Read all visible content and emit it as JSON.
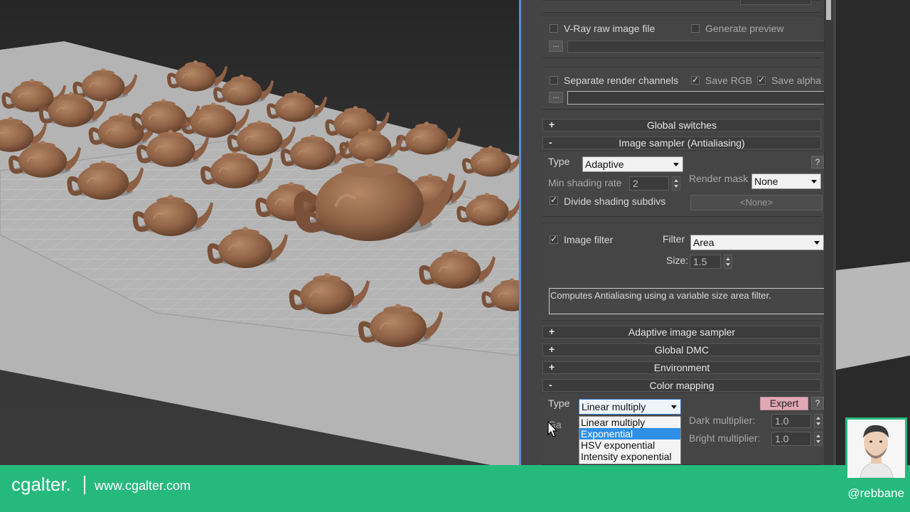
{
  "panel": {
    "vray_raw_label": "V-Ray raw image file",
    "generate_preview_label": "Generate preview",
    "browse_label": "...",
    "separate_channels_label": "Separate render channels",
    "save_rgb_label": "Save RGB",
    "save_alpha_label": "Save alpha",
    "rollouts": {
      "global_switches": {
        "sign": "+",
        "title": "Global switches"
      },
      "image_sampler": {
        "sign": "-",
        "title": "Image sampler (Antialiasing)"
      },
      "adaptive_sampler": {
        "sign": "+",
        "title": "Adaptive image sampler"
      },
      "global_dmc": {
        "sign": "+",
        "title": "Global DMC"
      },
      "environment": {
        "sign": "+",
        "title": "Environment"
      },
      "color_mapping": {
        "sign": "-",
        "title": "Color mapping"
      }
    },
    "image_sampler": {
      "type_label": "Type",
      "type_value": "Adaptive",
      "help_label": "?",
      "min_shading_label": "Min shading rate",
      "min_shading_value": "2",
      "render_mask_label": "Render mask",
      "render_mask_value": "None",
      "divide_subdivs_label": "Divide shading subdivs",
      "none_button": "<None>",
      "image_filter_label": "Image filter",
      "filter_label": "Filter",
      "filter_value": "Area",
      "size_label": "Size:",
      "size_value": "1.5",
      "description": "Computes Antialiasing using a variable size area filter."
    },
    "color_mapping": {
      "type_label": "Type",
      "type_value": "Linear multiply",
      "expert_label": "Expert",
      "help_label": "?",
      "gamma_label": "Ga",
      "dark_label": "Dark multiplier:",
      "dark_value": "1.0",
      "bright_label": "Bright multiplier:",
      "bright_value": "1.0",
      "options": [
        "Linear multiply",
        "Exponential",
        "HSV exponential",
        "Intensity exponential"
      ],
      "highlighted": "Exponential"
    }
  },
  "footer": {
    "brand": "cgalter.",
    "website": "www.cgalter.com",
    "handle": "@rebbane"
  },
  "colors": {
    "accent_green": "#26b97e",
    "dropdown_highlight": "#2d8fe6",
    "expert_button": "#e1a8b8"
  }
}
